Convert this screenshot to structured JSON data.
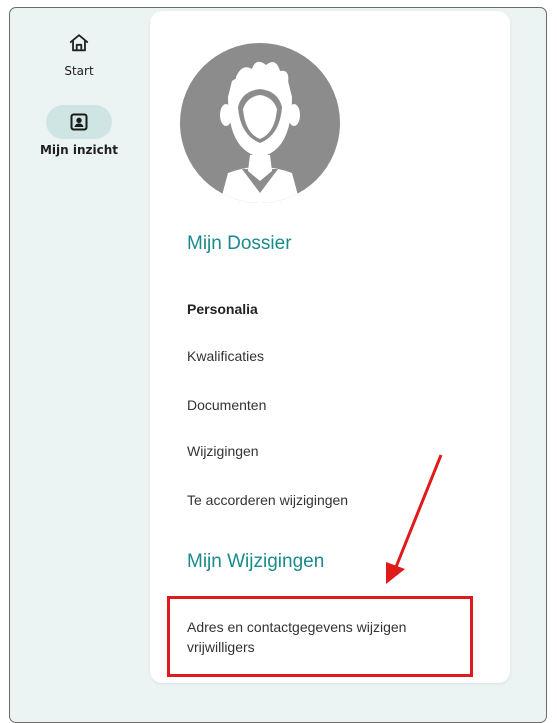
{
  "nav": {
    "items": [
      {
        "label": "Start",
        "icon": "home-icon",
        "active": false
      },
      {
        "label": "Mijn inzicht",
        "icon": "contact-card-icon",
        "active": true
      }
    ]
  },
  "dossier": {
    "title": "Mijn Dossier",
    "links": [
      "Personalia",
      "Kwalificaties",
      "Documenten",
      "Wijzigingen",
      "Te accorderen wijzigingen"
    ]
  },
  "wijzigingen": {
    "title": "Mijn Wijzigingen",
    "links": [
      "Adres en contactgegevens wijzigen vrijwilligers"
    ]
  },
  "colors": {
    "accent": "#1a8a8a",
    "sidebar_bg": "#ecf3f3",
    "active_pill": "#cfe5e4",
    "annotation": "#e0191b",
    "avatar_bg": "#8c8c8c"
  }
}
